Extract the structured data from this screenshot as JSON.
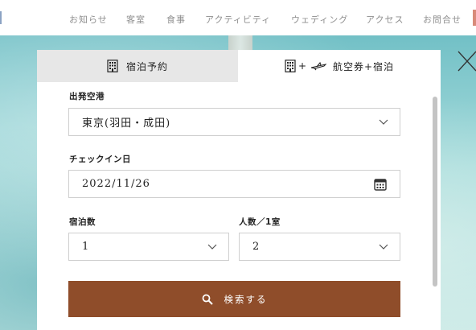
{
  "nav": {
    "items": [
      "お知らせ",
      "客室",
      "食事",
      "アクティビティ",
      "ウェディング",
      "アクセス",
      "お問合せ"
    ]
  },
  "tabs": {
    "stay_label": "宿泊予約",
    "air_plus": "+",
    "air_label": "航空券+宿泊"
  },
  "form": {
    "departure_label": "出発空港",
    "departure_value": "東京(羽田・成田)",
    "checkin_label": "チェックイン日",
    "checkin_value": "2022/11/26",
    "nights_label": "宿泊数",
    "nights_value": "1",
    "people_label": "人数／1室",
    "people_value": "2",
    "search_label": "検索する"
  },
  "colors": {
    "accent": "#8f4d2a",
    "tab_inactive": "#e7e7e7"
  },
  "icons": {
    "hotel": "hotel-building-icon",
    "plane": "airplane-icon",
    "calendar": "calendar-icon",
    "search": "search-icon",
    "close": "close-icon",
    "chevron": "chevron-down-icon"
  }
}
